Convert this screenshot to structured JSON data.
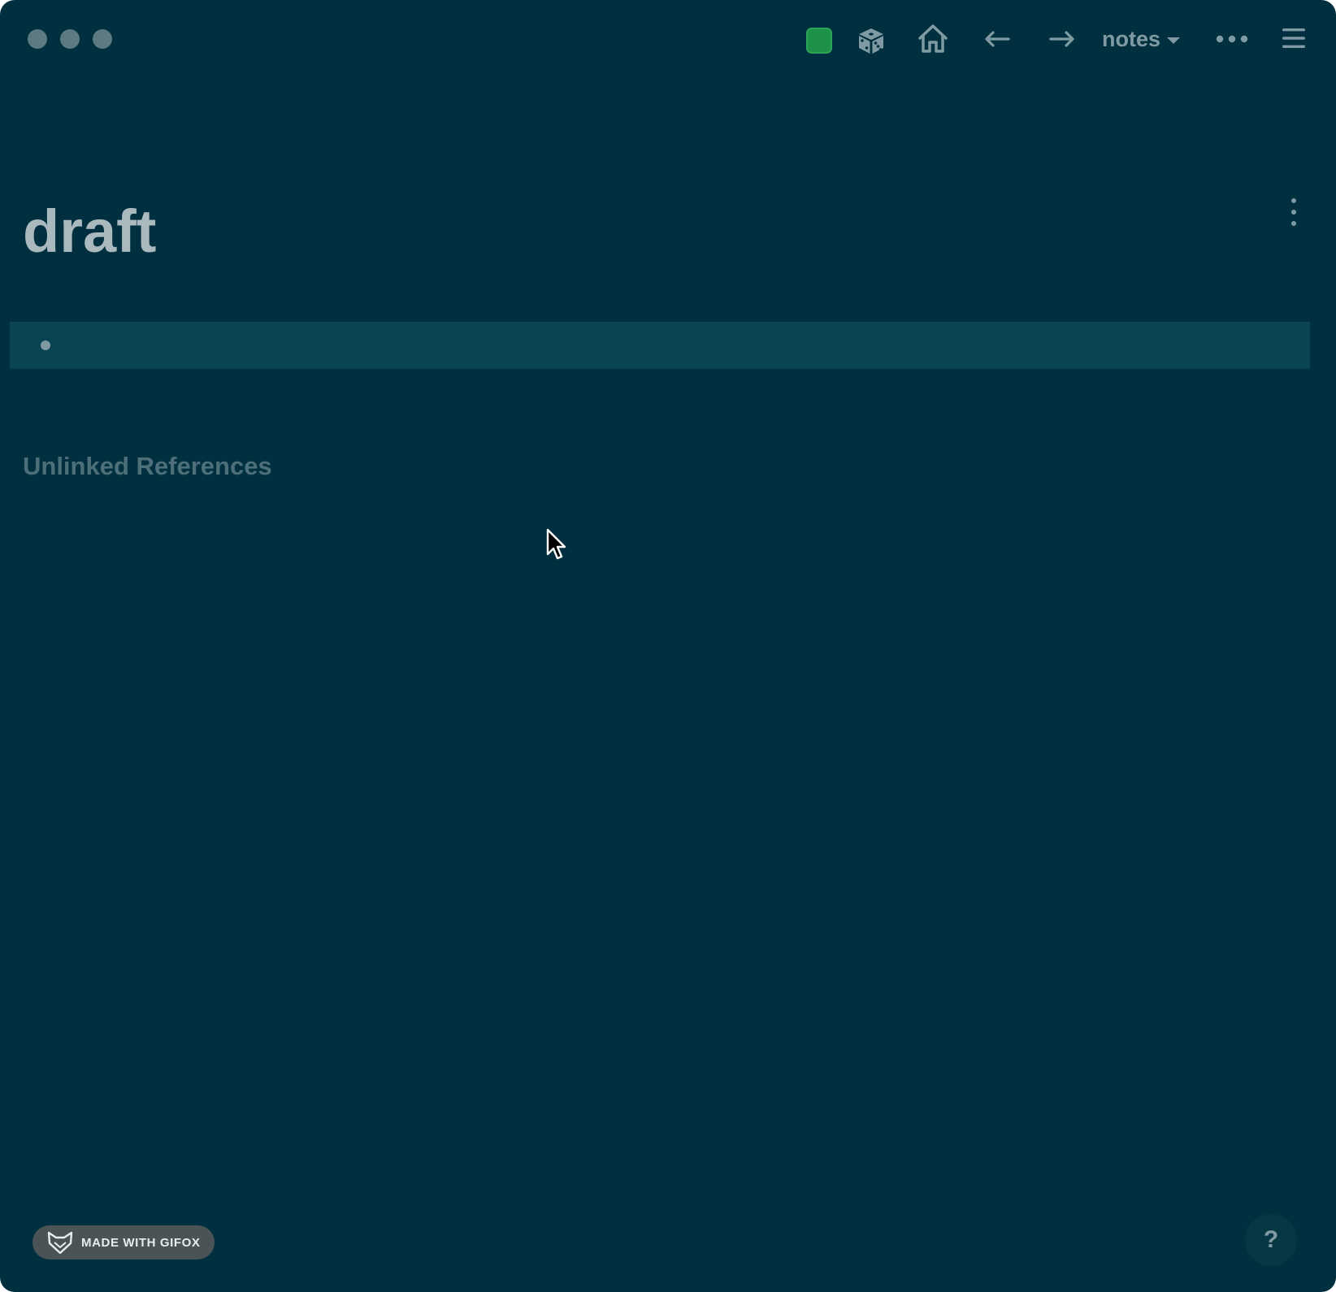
{
  "window": {
    "traffic_lights": [
      "close",
      "minimize",
      "zoom"
    ]
  },
  "toolbar": {
    "sync_status_color": "#1e9148",
    "icons": {
      "random": "dice-icon",
      "home": "home-icon",
      "back": "arrow-left-icon",
      "forward": "arrow-right-icon",
      "more": "more-horizontal-icon",
      "menu": "hamburger-menu-icon"
    },
    "graph_selector": {
      "label": "notes"
    }
  },
  "page": {
    "title": "draft",
    "blocks": [
      {
        "text": ""
      }
    ],
    "unlinked_references_label": "Unlinked References"
  },
  "watermark": {
    "text": "MADE WITH GIFOX"
  },
  "help": {
    "label": "?"
  },
  "colors": {
    "background": "#00303f",
    "block_highlight": "#0a4454",
    "muted_text": "#7f9aa2",
    "title_text": "#a9b9bd",
    "section_text": "#4c6f79"
  }
}
